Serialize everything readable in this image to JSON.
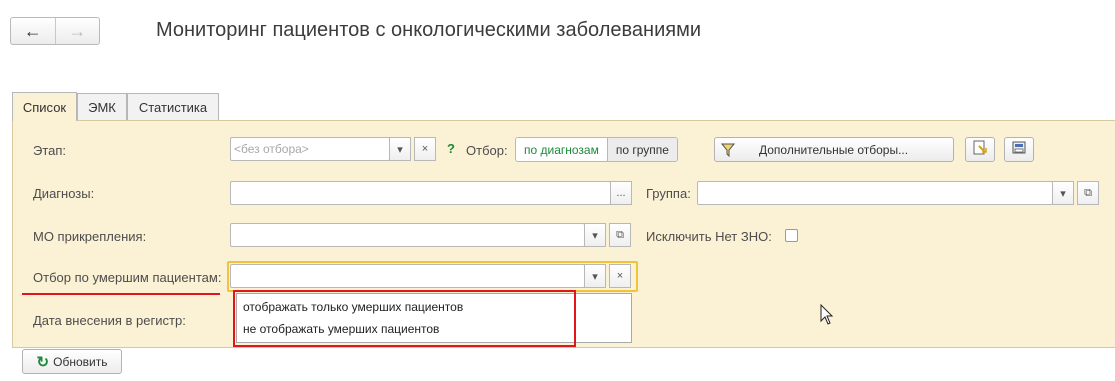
{
  "window": {
    "title": "Мониторинг пациентов с онкологическими заболеваниями"
  },
  "nav": {
    "back_glyph": "←",
    "forward_glyph": "→"
  },
  "tabs": [
    {
      "label": "Список",
      "active": true
    },
    {
      "label": "ЭМК",
      "active": false
    },
    {
      "label": "Статистика",
      "active": false
    }
  ],
  "filters": {
    "stage_label": "Этап:",
    "stage_placeholder": "<без отбора>",
    "help_glyph": "?",
    "selection_label": "Отбор:",
    "by_diagnoses": "по диагнозам",
    "by_group": "по группе",
    "additional_filters": "Дополнительные отборы...",
    "diagnoses_label": "Диагнозы:",
    "ellipsis": "...",
    "group_label": "Группа:",
    "mo_label": "МО прикрепления:",
    "exclude_label": "Исключить Нет ЗНО:",
    "deceased_label": "Отбор по умершим пациентам:",
    "register_date_label": "Дата внесения в регистр:",
    "dropdown_glyph": "▾",
    "clear_glyph": "×",
    "open_glyph": "⧉"
  },
  "dropdown_options": [
    "отображать только умерших пациентов",
    "не отображать умерших пациентов"
  ],
  "refresh": {
    "icon_glyph": "↻",
    "label": "Обновить"
  },
  "colors": {
    "panel": "#fbf1d4",
    "accent_green": "#1b8a3a",
    "highlight_red": "#e0161c",
    "active_field_border": "#f0c43a"
  }
}
